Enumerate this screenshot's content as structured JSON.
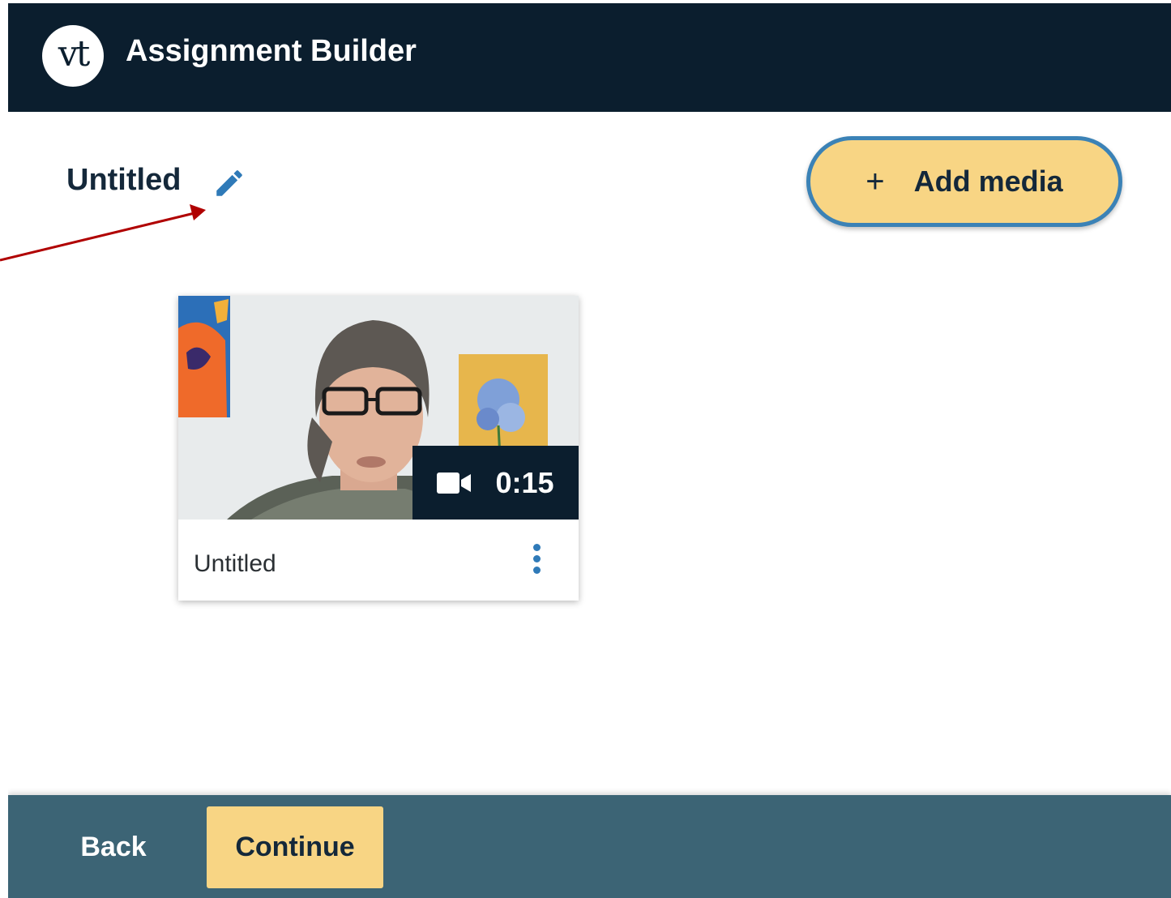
{
  "header": {
    "logo_text": "vt",
    "app_title": "Assignment Builder"
  },
  "title_row": {
    "title": "Untitled",
    "edit_icon": "pencil-icon",
    "add_media_icon": "plus-icon",
    "add_media_label": "Add media"
  },
  "media_card": {
    "duration": "0:15",
    "media_type_icon": "video-camera-icon",
    "title": "Untitled",
    "menu_icon": "more-vertical-icon"
  },
  "footer": {
    "back_label": "Back",
    "continue_label": "Continue"
  },
  "colors": {
    "header_bg": "#0b1e2e",
    "accent_yellow": "#f8d584",
    "accent_blue": "#2f7ab8",
    "footer_bg": "#3c6475",
    "annotation_red": "#b00000"
  }
}
